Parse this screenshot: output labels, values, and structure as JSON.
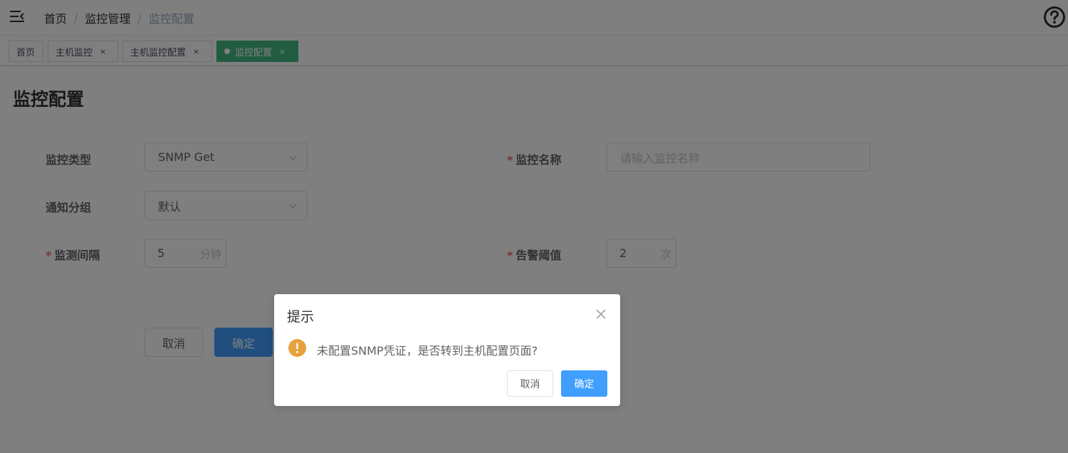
{
  "header": {
    "breadcrumb": [
      "首页",
      "监控管理",
      "监控配置"
    ],
    "separator": "/"
  },
  "tags": [
    {
      "label": "首页",
      "closable": false,
      "active": false
    },
    {
      "label": "主机监控",
      "closable": true,
      "active": false
    },
    {
      "label": "主机监控配置",
      "closable": true,
      "active": false
    },
    {
      "label": "监控配置",
      "closable": true,
      "active": true
    }
  ],
  "tag_close_glyph": "×",
  "page": {
    "title": "监控配置",
    "form": {
      "monitor_type": {
        "label": "监控类型",
        "value": "SNMP Get"
      },
      "monitor_name": {
        "label": "监控名称",
        "placeholder": "请输入监控名称",
        "required_mark": "*"
      },
      "notify_group": {
        "label": "通知分组",
        "value": "默认"
      },
      "interval": {
        "label": "监测间隔",
        "value": "5",
        "unit": "分钟",
        "required_mark": "*"
      },
      "threshold": {
        "label": "告警阈值",
        "value": "2",
        "unit": "次",
        "required_mark": "*"
      }
    },
    "buttons": {
      "cancel": "取消",
      "confirm": "确定"
    }
  },
  "dialog": {
    "title": "提示",
    "message": "未配置SNMP凭证，是否转到主机配置页面?",
    "cancel_label": "取消",
    "confirm_label": "确定"
  },
  "colors": {
    "tag_active": "#42b983",
    "primary": "#409eff",
    "warning": "#e6a23c",
    "required": "#f56c6c"
  },
  "icons": [
    "hamburger-icon",
    "help-icon",
    "chevron-down-icon",
    "close-icon",
    "warning-icon"
  ]
}
